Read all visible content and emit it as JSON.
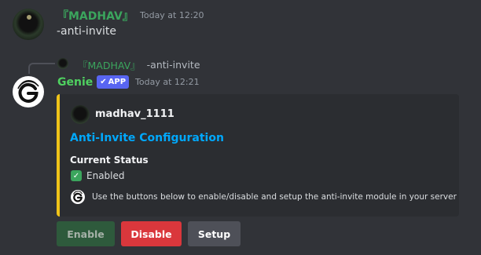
{
  "message1": {
    "username": "『MADHAV』",
    "timestamp": "Today at 12:20",
    "content": "-anti-invite"
  },
  "reply": {
    "username": "『MADHAV』",
    "content": "-anti-invite"
  },
  "message2": {
    "username": "Genie",
    "badge": "APP",
    "timestamp": "Today at 12:21"
  },
  "embed": {
    "accent_color": "#f0c419",
    "author": "madhav_1111",
    "title": "Anti-Invite Configuration",
    "field_name": "Current Status",
    "field_value": "Enabled",
    "footer": "Use the buttons below to enable/disable and setup the anti-invite module in your server"
  },
  "buttons": {
    "enable": "Enable",
    "disable": "Disable",
    "setup": "Setup"
  },
  "colors": {
    "background": "#313338",
    "embed_bg": "#2b2d31",
    "username_green": "#3ba55d",
    "link_blue": "#00a8fc",
    "danger_red": "#da373c",
    "app_badge": "#5865f2"
  }
}
